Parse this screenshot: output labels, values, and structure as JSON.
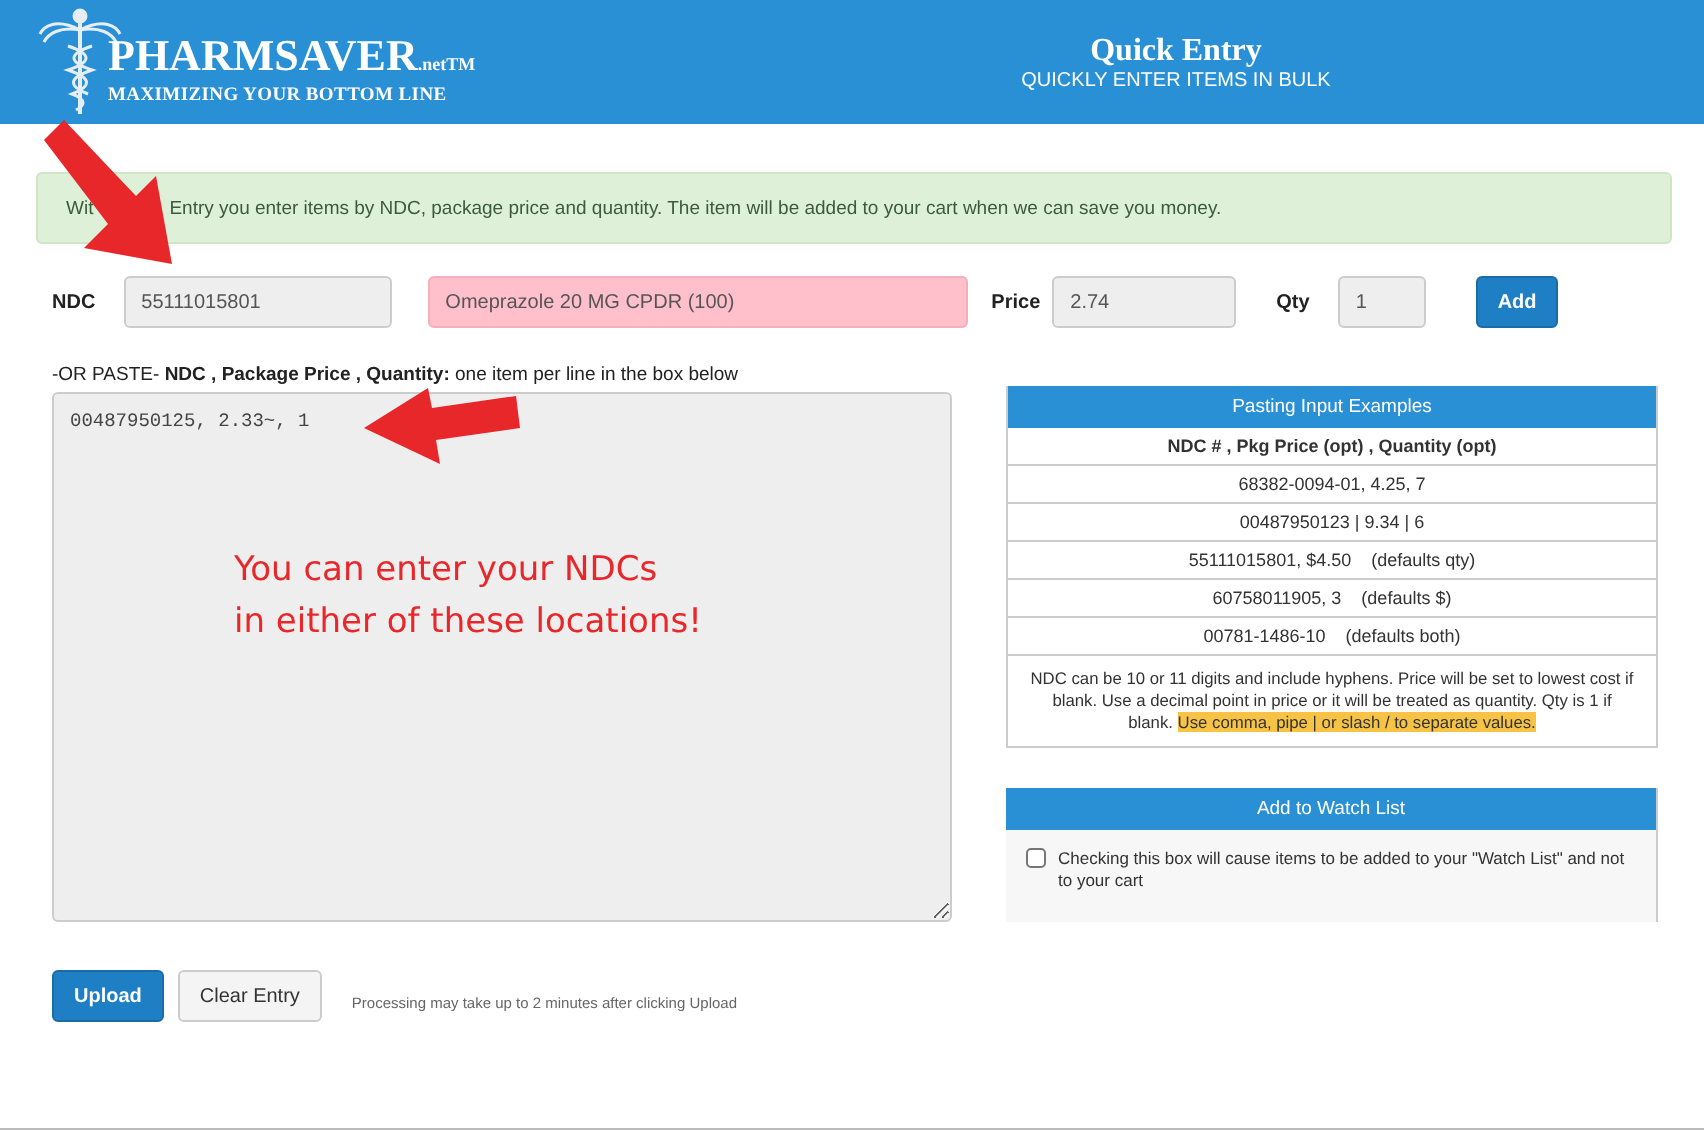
{
  "header": {
    "logo": "PHARMSAVER",
    "logo_suffix": ".net",
    "logo_tm": "TM",
    "tagline": "MAXIMIZING YOUR BOTTOM LINE",
    "title": "Quick Entry",
    "subtitle": "QUICKLY ENTER ITEMS IN BULK"
  },
  "info": [
    "Wit",
    "Entry you enter items by NDC, package price and quantity. The item will be added to your cart when we can save you money."
  ],
  "entry": {
    "ndc_label": "NDC",
    "ndc_value": "55111015801",
    "product": "Omeprazole 20 MG CPDR (100)",
    "price_label": "Price",
    "price_value": "2.74",
    "qty_label": "Qty",
    "qty_value": "1",
    "add_button": "Add"
  },
  "paste": {
    "label": "-OR PASTE- **NDC , Package Price , Quantity:** one item per line in the box below",
    "value": "00487950125, 2.33~, 1"
  },
  "examples": {
    "title": "Pasting Input Examples",
    "heading": "NDC # , Pkg Price (opt) , Quantity (opt)",
    "rows": [
      "68382-0094-01, 4.25, 7",
      "00487950123 | 9.34 | 6",
      "55111015801, $4.50    (defaults qty)",
      "60758011905, 3    (defaults $)",
      "00781-1486-10    (defaults both)"
    ],
    "note": "NDC can be 10 or 11 digits and include hyphens. Price will be set to lowest cost if blank. Use a decimal point in price or it will be treated as quantity. Qty is 1 if blank. ",
    "note_highlight": "Use comma, pipe | or slash / to separate values."
  },
  "watch": {
    "title": "Add to Watch List",
    "label": "Checking this box will cause items to be added to your \"Watch List\" and not to your cart",
    "checked": false
  },
  "buttons": {
    "upload": "Upload",
    "clear": "Clear Entry",
    "note": "Processing may take up to 2 minutes after clicking Upload"
  },
  "annotation": {
    "text_lines": [
      "You can enter your NDCs",
      "in either of these locations!"
    ]
  }
}
